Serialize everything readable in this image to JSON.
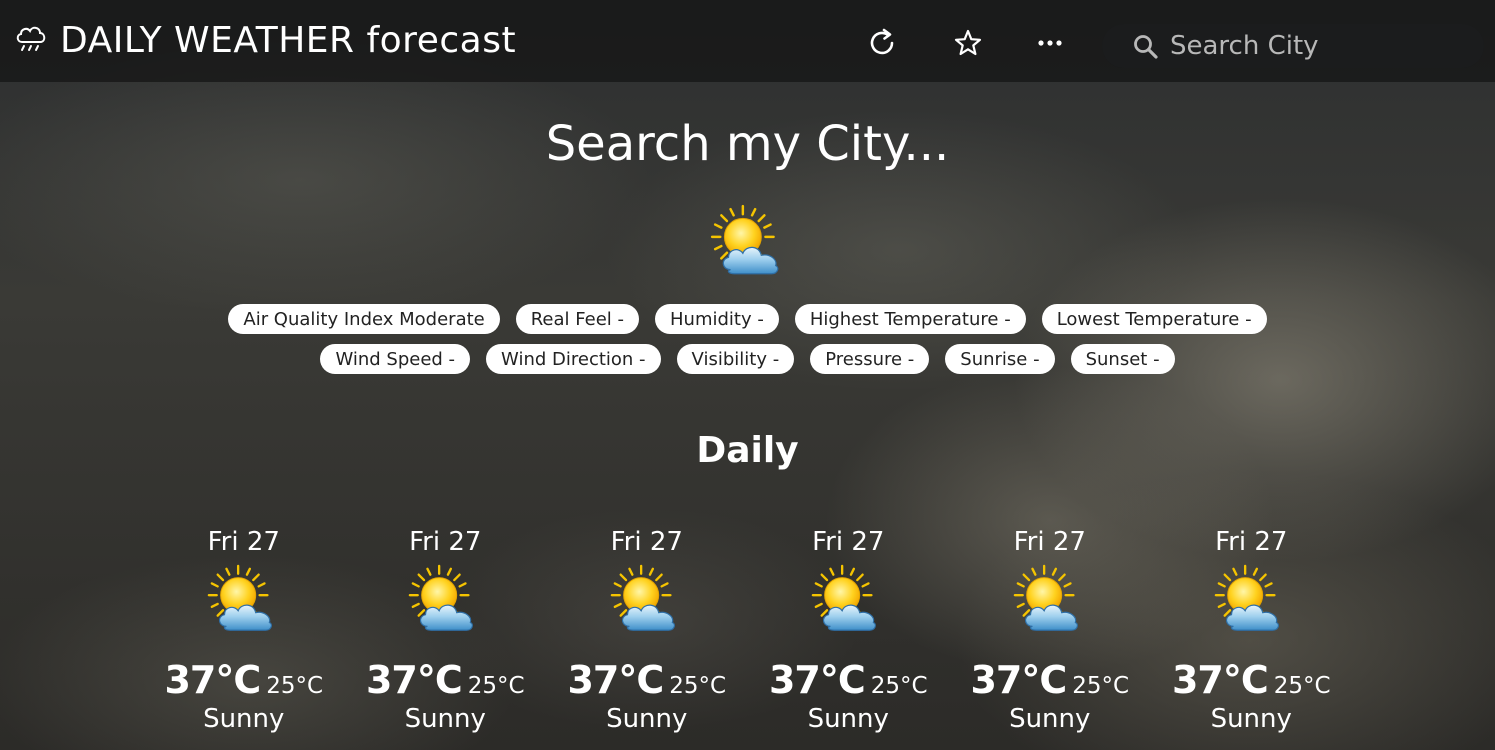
{
  "header": {
    "title": "DAILY WEATHER forecast",
    "search_placeholder": "Search City"
  },
  "hero": {
    "title": "Search my City...",
    "weather_icon": "sun-behind-cloud-icon"
  },
  "details": {
    "row1": [
      "Air Quality Index Moderate",
      "Real Feel -",
      "Humidity -",
      "Highest Temperature -",
      "Lowest Temperature -"
    ],
    "row2": [
      "Wind Speed -",
      "Wind Direction -",
      "Visibility -",
      "Pressure -",
      "Sunrise -",
      "Sunset -"
    ]
  },
  "daily": {
    "title": "Daily",
    "days": [
      {
        "label": "Fri 27",
        "high": "37°C",
        "low": "25°C",
        "condition": "Sunny",
        "icon": "sun-behind-cloud-icon"
      },
      {
        "label": "Fri 27",
        "high": "37°C",
        "low": "25°C",
        "condition": "Sunny",
        "icon": "sun-behind-cloud-icon"
      },
      {
        "label": "Fri 27",
        "high": "37°C",
        "low": "25°C",
        "condition": "Sunny",
        "icon": "sun-behind-cloud-icon"
      },
      {
        "label": "Fri 27",
        "high": "37°C",
        "low": "25°C",
        "condition": "Sunny",
        "icon": "sun-behind-cloud-icon"
      },
      {
        "label": "Fri 27",
        "high": "37°C",
        "low": "25°C",
        "condition": "Sunny",
        "icon": "sun-behind-cloud-icon"
      },
      {
        "label": "Fri 27",
        "high": "37°C",
        "low": "25°C",
        "condition": "Sunny",
        "icon": "sun-behind-cloud-icon"
      }
    ]
  }
}
